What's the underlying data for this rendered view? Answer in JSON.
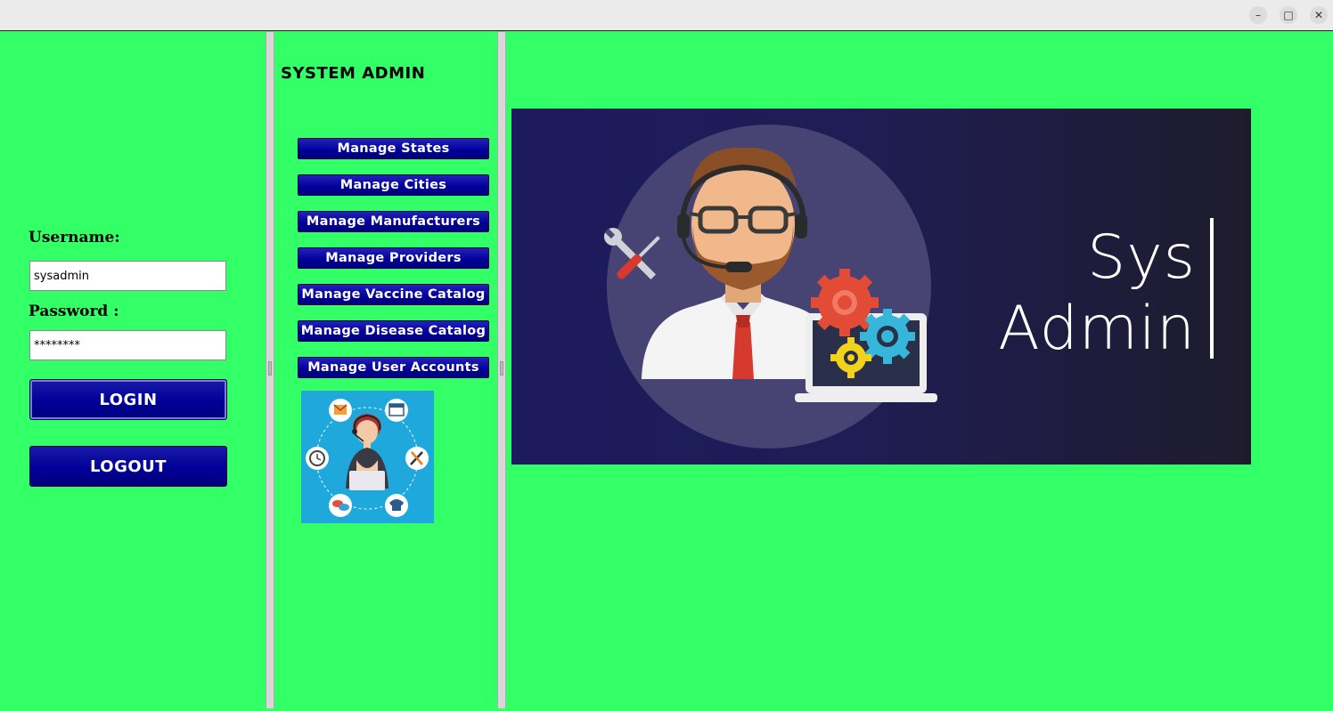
{
  "window": {
    "controls": [
      "minimize-icon",
      "maximize-icon",
      "close-icon"
    ]
  },
  "login": {
    "username_label": "Username:",
    "username_value": "sysadmin",
    "password_label": "Password :",
    "password_value": "********",
    "login_label": "LOGIN",
    "logout_label": "LOGOUT"
  },
  "admin_panel": {
    "title": "SYSTEM ADMIN",
    "menu": [
      {
        "label": "Manage States"
      },
      {
        "label": "Manage Cities"
      },
      {
        "label": "Manage Manufacturers"
      },
      {
        "label": "Manage Providers"
      },
      {
        "label": "Manage Vaccine Catalog"
      },
      {
        "label": "Manage Disease Catalog"
      },
      {
        "label": "Manage User Accounts"
      }
    ]
  },
  "banner": {
    "line1": "Sys",
    "line2": "Admin"
  },
  "colors": {
    "background": "#33ff66",
    "button": "#000099",
    "banner_bg": "#1d1a5e"
  }
}
